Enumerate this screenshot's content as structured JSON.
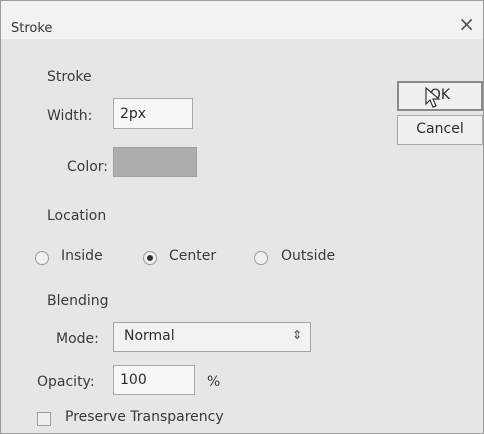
{
  "window": {
    "title": "Stroke",
    "close_glyph": "×"
  },
  "stroke": {
    "section_label": "Stroke",
    "width_label": "Width:",
    "width_value": "2px",
    "color_label": "Color:",
    "color_value": "#aeaeae"
  },
  "location": {
    "section_label": "Location",
    "options": [
      "Inside",
      "Center",
      "Outside"
    ],
    "selected": "Center"
  },
  "blending": {
    "section_label": "Blending",
    "mode_label": "Mode:",
    "mode_value": "Normal",
    "opacity_label": "Opacity:",
    "opacity_value": "100",
    "opacity_unit": "%",
    "preserve_label": "Preserve Transparency",
    "preserve_checked": false
  },
  "buttons": {
    "ok_label": "OK",
    "cancel_label": "Cancel"
  },
  "icons": {
    "cursor": "mouse-pointer-icon",
    "select_arrow": "up-down-chevron-icon"
  }
}
